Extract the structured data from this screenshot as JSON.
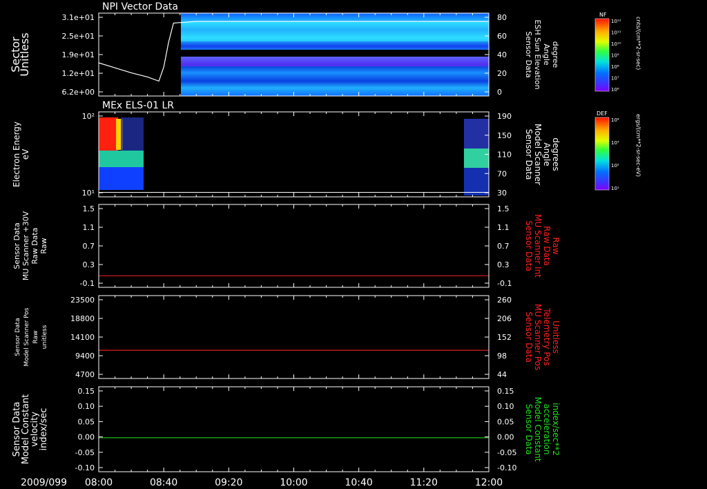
{
  "chart_data": [
    {
      "type": "heatmap",
      "title": "NPI Vector Data",
      "ylabel_left": [
        "Sector",
        "Unitless"
      ],
      "yticks_left": [
        "3.1e+01",
        "2.5e+01",
        "1.9e+01",
        "1.2e+01",
        "6.2e+00"
      ],
      "ylabel_right": [
        "Sensor Data",
        "ESH Sun Elevation",
        "Angle",
        "degree"
      ],
      "yticks_right": [
        "80",
        "60",
        "40",
        "20",
        "0"
      ],
      "ylim_right": [
        -20,
        80
      ],
      "overlay_line": {
        "x": [
          "08:00",
          "08:10",
          "08:20",
          "08:30",
          "08:37",
          "08:40",
          "08:43",
          "08:46",
          "09:00",
          "12:00"
        ],
        "y": [
          20,
          14,
          8,
          3,
          -2,
          15,
          45,
          68,
          70,
          70
        ]
      },
      "data_starts": "08:45",
      "colorbar": {
        "label": "NF",
        "ticks": [
          "10¹²",
          "10¹¹",
          "10¹⁰",
          "10⁹",
          "10⁸",
          "10⁷",
          "10⁶"
        ],
        "units": "cnts/(cm**2-sr-sec)"
      }
    },
    {
      "type": "heatmap",
      "title": "MEx ELS-01 LR",
      "ylabel_left": [
        "Electron Energy",
        "eV"
      ],
      "yticks_left": [
        "10²",
        "10¹"
      ],
      "ylabel_right": [
        "Sensor Data",
        "Model Scanner",
        "Angle",
        "degrees"
      ],
      "yticks_right": [
        "190",
        "150",
        "110",
        "70",
        "30"
      ],
      "ylim_right": [
        0,
        190
      ],
      "overlay_line": {
        "x": [
          "08:00",
          "12:00"
        ],
        "y": [
          10,
          10
        ]
      },
      "colorbar": {
        "label": "DEF",
        "ticks": [
          "10⁴",
          "10³",
          "10²",
          "10¹"
        ],
        "units": "ergs/(cm**2-sr-sec-eV)"
      }
    },
    {
      "type": "line",
      "ylabel_left": [
        "Sensor Data",
        "MU Scanner +30V",
        "Raw Data",
        "Raw"
      ],
      "yticks_left": [
        "1.5",
        "1.1",
        "0.7",
        "0.3",
        "-0.1"
      ],
      "ylabel_right": [
        "Sensor Data",
        "MU Scanner Int",
        "Raw Data",
        "Raw"
      ],
      "yticks_right": [
        "1.5",
        "1.1",
        "0.7",
        "0.3",
        "-0.1"
      ],
      "ylim": [
        -0.3,
        1.5
      ],
      "series": [
        {
          "color": "#e02020",
          "x": [
            "08:00",
            "12:00"
          ],
          "y": [
            -0.05,
            -0.05
          ]
        }
      ]
    },
    {
      "type": "line",
      "ylabel_left": [
        "Sensor Data",
        "Model Scanner Pos",
        "Raw",
        "unitless"
      ],
      "yticks_left": [
        "23500",
        "18800",
        "14100",
        "9400",
        "4700"
      ],
      "ylabel_right": [
        "Sensor Data",
        "MU Scanner Pos",
        "Telemetry Pos",
        "Unitless"
      ],
      "yticks_right": [
        "260",
        "206",
        "152",
        "98",
        "44"
      ],
      "ylim": [
        0,
        23500
      ],
      "series": [
        {
          "color": "#e02020",
          "x": [
            "08:00",
            "12:00"
          ],
          "y": [
            8000,
            8000
          ]
        }
      ]
    },
    {
      "type": "line",
      "ylabel_left": [
        "Sensor Data",
        "Model Constant",
        "velocity",
        "index/sec"
      ],
      "yticks_left": [
        "0.15",
        "0.10",
        "0.05",
        "0.00",
        "-0.05",
        "-0.10"
      ],
      "ylabel_right": [
        "Sensor Data",
        "Model Constant",
        "acceleration",
        "index/sec**2"
      ],
      "yticks_right": [
        "0.15",
        "0.10",
        "0.05",
        "0.00",
        "-0.05",
        "-0.10"
      ],
      "ylim": [
        -0.1,
        0.15
      ],
      "series": [
        {
          "color": "#20d020",
          "x": [
            "08:00",
            "12:00"
          ],
          "y": [
            0.0,
            0.0
          ]
        }
      ]
    }
  ],
  "time_axis": {
    "date": "2009/099",
    "ticks": [
      "08:00",
      "08:40",
      "09:20",
      "10:00",
      "10:40",
      "11:20",
      "12:00"
    ]
  },
  "colors": {
    "background": "#000000",
    "red_label": "#ff2020",
    "green_label": "#20e020"
  }
}
